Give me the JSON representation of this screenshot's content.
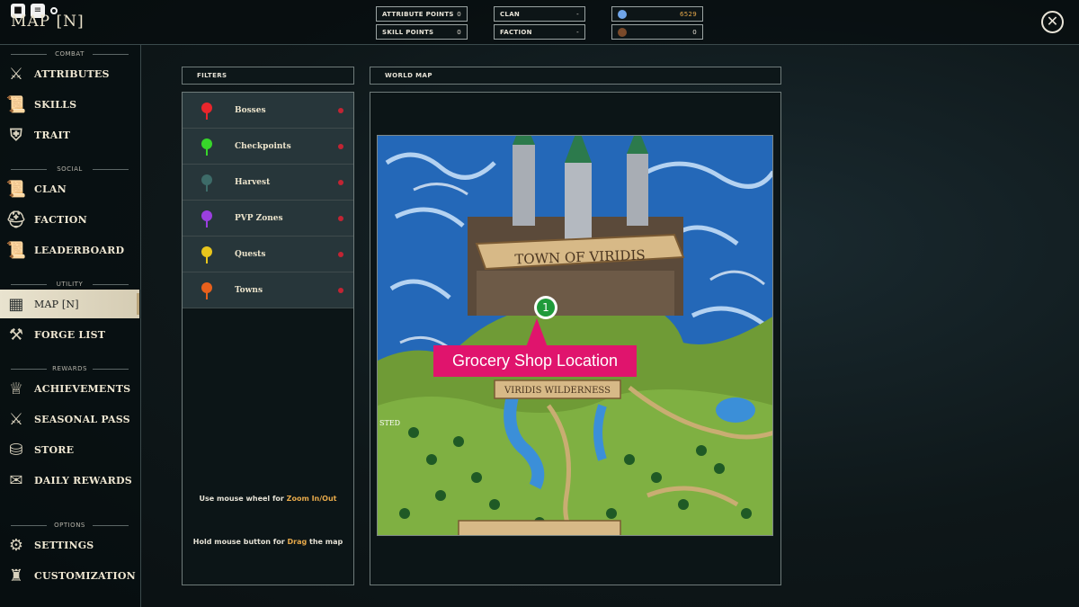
{
  "header": {
    "title": "MAP [N]",
    "stats": {
      "attribute_points_label": "ATTRIBUTE POINTS",
      "attribute_points_value": "0",
      "skill_points_label": "SKILL POINTS",
      "skill_points_value": "0",
      "clan_label": "CLAN",
      "clan_value": "-",
      "faction_label": "FACTION",
      "faction_value": "-",
      "currency1_value": "6529",
      "currency2_value": "0"
    },
    "close_glyph": "✕"
  },
  "sidebar": {
    "sections": {
      "combat": "COMBAT",
      "social": "SOCIAL",
      "utility": "UTILITY",
      "rewards": "REWARDS",
      "options": "OPTIONS"
    },
    "items": [
      {
        "label": "ATTRIBUTES",
        "icon": "sword-icon"
      },
      {
        "label": "SKILLS",
        "icon": "scroll-icon"
      },
      {
        "label": "TRAIT",
        "icon": "armor-icon"
      },
      {
        "label": "CLAN",
        "icon": "scroll-icon"
      },
      {
        "label": "FACTION",
        "icon": "helmet-icon"
      },
      {
        "label": "LEADERBOARD",
        "icon": "scroll-icon"
      },
      {
        "label": "MAP [N]",
        "icon": "map-icon"
      },
      {
        "label": "FORGE LIST",
        "icon": "hammer-icon"
      },
      {
        "label": "ACHIEVEMENTS",
        "icon": "trophy-icon"
      },
      {
        "label": "SEASONAL PASS",
        "icon": "sword-icon"
      },
      {
        "label": "STORE",
        "icon": "coins-icon"
      },
      {
        "label": "DAILY REWARDS",
        "icon": "gift-icon"
      },
      {
        "label": "SETTINGS",
        "icon": "gear-icon"
      },
      {
        "label": "CUSTOMIZATION",
        "icon": "figure-icon"
      }
    ],
    "active_item": "MAP [N]"
  },
  "filters": {
    "heading": "FILTERS",
    "rows": [
      {
        "label": "Bosses",
        "color": "#e8262c"
      },
      {
        "label": "Checkpoints",
        "color": "#37d62a"
      },
      {
        "label": "Harvest",
        "color": "#3d6b68"
      },
      {
        "label": "PVP Zones",
        "color": "#9b3fe0"
      },
      {
        "label": "Quests",
        "color": "#e8c51c"
      },
      {
        "label": "Towns",
        "color": "#e8601c"
      }
    ],
    "hint_zoom_prefix": "Use mouse wheel for ",
    "hint_zoom_highlight": "Zoom In/Out",
    "hint_drag_prefix": "Hold mouse button for ",
    "hint_drag_highlight": "Drag",
    "hint_drag_suffix": " the map"
  },
  "world_map": {
    "heading": "WORLD MAP",
    "town_banner": "TOWN OF VIRIDIS",
    "wilderness_banner": "VIRIDIS WILDERNESS",
    "edge_label_left": "STED",
    "marker_number": "1",
    "callout": "Grocery Shop Location"
  }
}
